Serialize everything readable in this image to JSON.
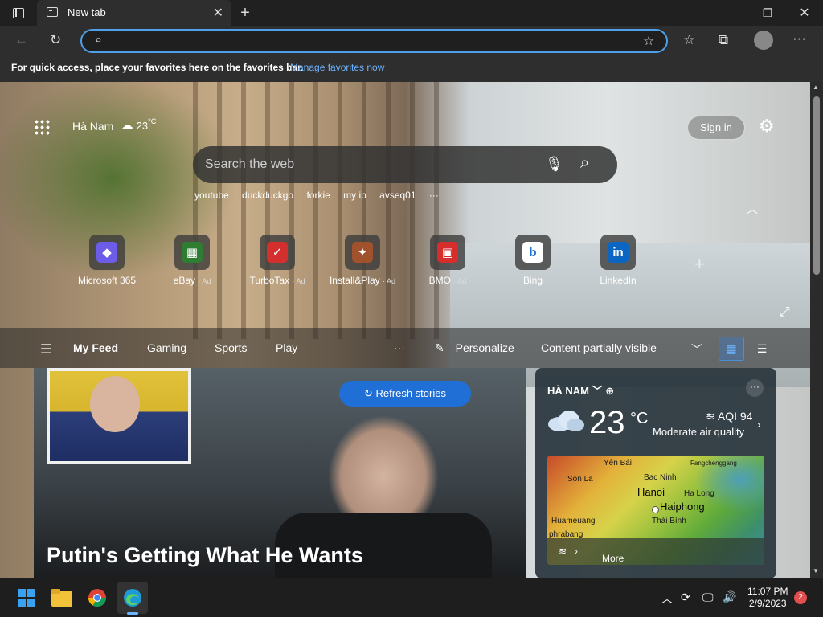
{
  "browser": {
    "tab_title": "New tab",
    "address_value": "",
    "favorites_bar_text": "For quick access, place your favorites here on the favorites bar.",
    "favorites_bar_link": "Manage favorites now"
  },
  "newtab": {
    "location": "Hà Nam",
    "weather_temp": "23",
    "weather_unit": "°C",
    "sign_in": "Sign in",
    "search_placeholder": "Search the web",
    "suggestions": [
      "youtube",
      "duckduckgo",
      "forkie",
      "my ip",
      "avseq01"
    ],
    "quick_links": [
      {
        "label": "Microsoft 365",
        "ad": "",
        "icon": "microsoft365-icon",
        "color": "#6c5ce7",
        "glyph": "◆"
      },
      {
        "label": "eBay",
        "ad": "· Ad",
        "icon": "ebay-icon",
        "color": "#2e7d32",
        "glyph": "▦"
      },
      {
        "label": "TurboTax",
        "ad": "· Ad",
        "icon": "turbotax-icon",
        "color": "#d32f2f",
        "glyph": "✓"
      },
      {
        "label": "Install&Play",
        "ad": "· Ad",
        "icon": "installplay-icon",
        "color": "#a0522d",
        "glyph": "✦"
      },
      {
        "label": "BMO",
        "ad": "· Ad",
        "icon": "bmo-icon",
        "color": "#d62d2d",
        "glyph": "▣"
      },
      {
        "label": "Bing",
        "ad": "",
        "icon": "bing-icon",
        "color": "#ffffff",
        "glyph": "b"
      },
      {
        "label": "LinkedIn",
        "ad": "",
        "icon": "linkedin-icon",
        "color": "#0a66c2",
        "glyph": "in"
      }
    ]
  },
  "feed_nav": {
    "tabs": [
      "My Feed",
      "Gaming",
      "Sports",
      "Play"
    ],
    "more": "···",
    "personalize": "Personalize",
    "content_visibility": "Content partially visible"
  },
  "hero": {
    "refresh_label": "Refresh stories",
    "headline": "Putin's Getting What He Wants"
  },
  "weather_card": {
    "location": "HÀ NAM",
    "temp": "23",
    "unit": "°C",
    "aqi": "AQI 94",
    "aqi_desc": "Moderate air quality",
    "map_places": [
      "Yên Bái",
      "Bac Ninh",
      "Son La",
      "Hanoi",
      "Fangchenggang",
      "Ha Long",
      "Haiphong",
      "Huameuang",
      "Thái Bình",
      "phrabang"
    ],
    "map_link": "More AQ info nearby"
  },
  "taskbar": {
    "time": "11:07 PM",
    "date": "2/9/2023",
    "notifications": "2"
  },
  "colors": {
    "accent": "#1f6fd6",
    "address_border": "#4ea1e8",
    "link": "#6cb4ff"
  }
}
